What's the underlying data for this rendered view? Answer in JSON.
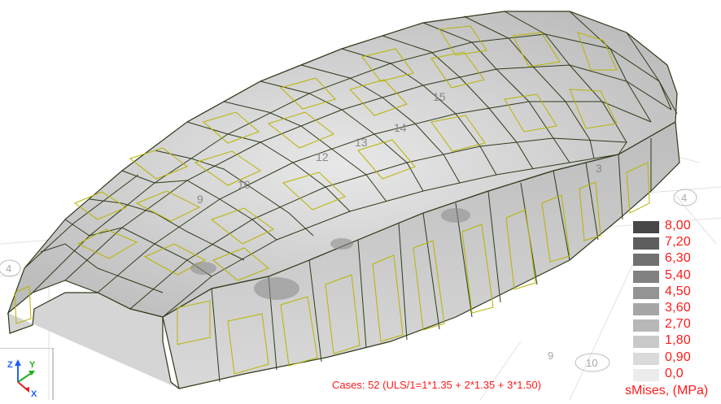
{
  "viewport": {
    "grid_labels": [
      "4",
      "4",
      "10",
      "9"
    ],
    "panel_labels": [
      "15",
      "14",
      "13",
      "12",
      "10",
      "9",
      "3"
    ]
  },
  "legend": {
    "title": "sMises, (MPa)",
    "text_color": "#ff1a1a",
    "items": [
      {
        "value": "8,00",
        "color": "#474747"
      },
      {
        "value": "7,20",
        "color": "#5e5e5e"
      },
      {
        "value": "6,30",
        "color": "#717171"
      },
      {
        "value": "5,40",
        "color": "#828282"
      },
      {
        "value": "4,50",
        "color": "#949494"
      },
      {
        "value": "3,60",
        "color": "#a6a6a6"
      },
      {
        "value": "2,70",
        "color": "#b8b8b8"
      },
      {
        "value": "1,80",
        "color": "#c9c9c9"
      },
      {
        "value": "0,90",
        "color": "#dadada"
      },
      {
        "value": "0,0",
        "color": "#ececec"
      }
    ]
  },
  "cases_label": "Cases: 52 (ULS/1=1*1.35 + 2*1.35 + 3*1.50)",
  "triad": {
    "z": "Z",
    "y": "Y",
    "x": "X"
  },
  "colors": {
    "mesh_line": "#2e3a1a",
    "inner_panel": "#b8b400",
    "accent_red": "#ff1a1a"
  }
}
